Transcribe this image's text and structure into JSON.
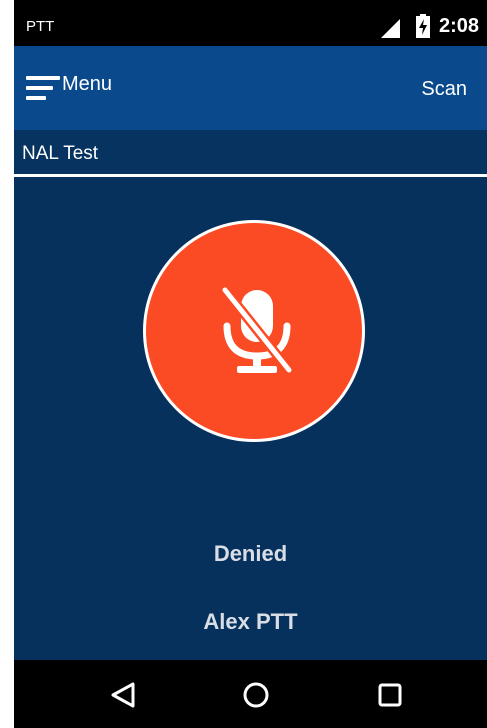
{
  "status_bar": {
    "app_name": "PTT",
    "time": "2:08",
    "icons": [
      "signal-icon",
      "battery-charging-icon"
    ]
  },
  "app_bar": {
    "menu_label": "Menu",
    "scan_label": "Scan",
    "menu_icon": "hamburger-menu-icon"
  },
  "channel": {
    "name": "NAL Test"
  },
  "ptt": {
    "button_icon": "mic-off-icon",
    "button_color": "#fb4b25",
    "status": "Denied",
    "user": "Alex PTT"
  },
  "colors": {
    "app_bar": "#0a4a8c",
    "background": "#06315d",
    "status_text": "#d9dee6"
  },
  "nav_bar": {
    "icons": [
      "back-icon",
      "home-icon",
      "recents-icon"
    ]
  }
}
